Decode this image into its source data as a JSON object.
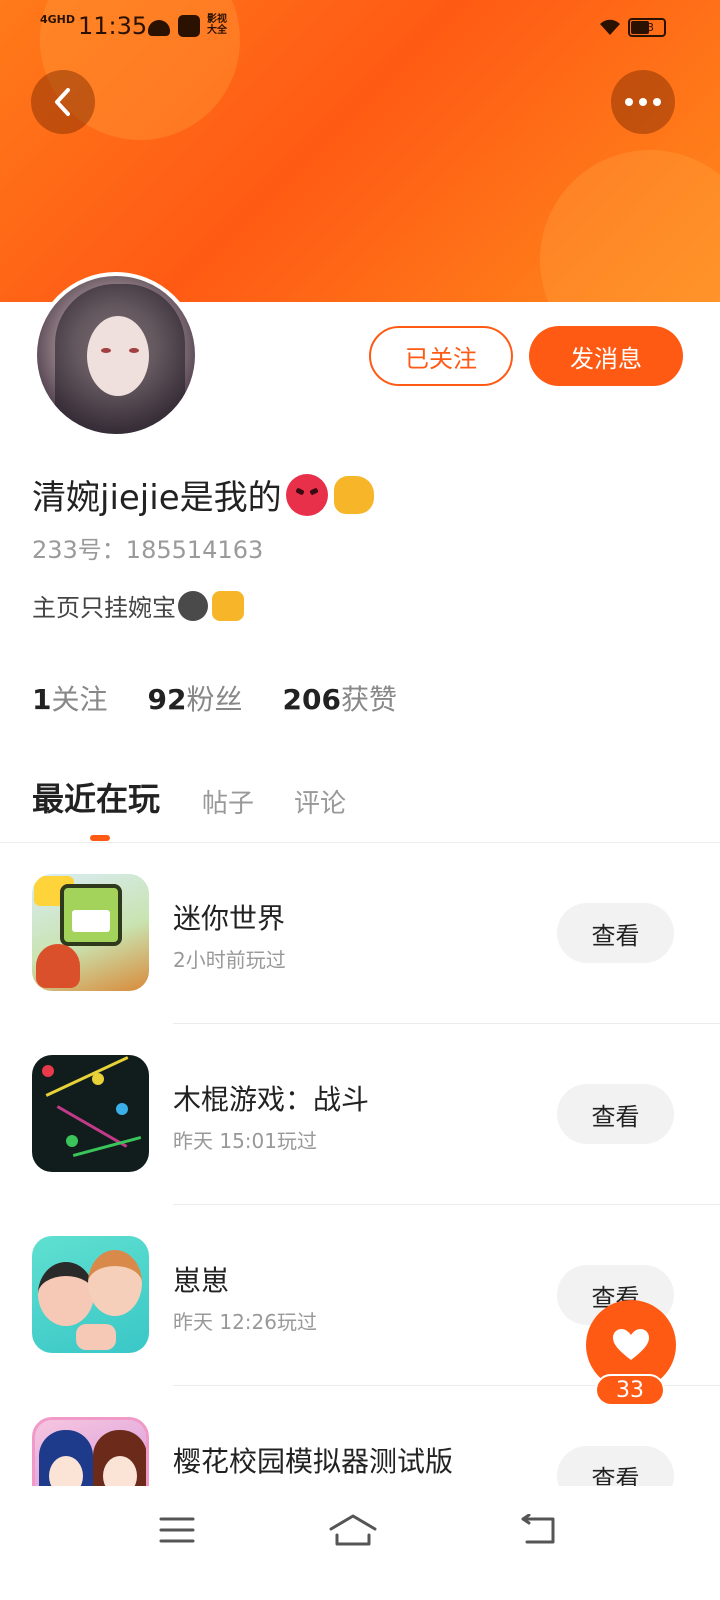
{
  "status_bar": {
    "network": "4GHD",
    "time": "11:35",
    "app_label": "影视大全",
    "battery": "43"
  },
  "profile": {
    "follow_button": "已关注",
    "message_button": "发消息",
    "username": "清婉jiejie是我的",
    "uid": "233号：185514163",
    "bio": "主页只挂婉宝"
  },
  "stats": [
    {
      "num": "1",
      "label": "关注"
    },
    {
      "num": "92",
      "label": "粉丝"
    },
    {
      "num": "206",
      "label": "获赞"
    }
  ],
  "tabs": [
    "最近在玩",
    "帖子",
    "评论"
  ],
  "games": [
    {
      "name": "迷你世界",
      "time": "2小时前玩过",
      "button": "查看"
    },
    {
      "name": "木棍游戏：战斗",
      "time": "昨天 15:01玩过",
      "button": "查看"
    },
    {
      "name": "崽崽",
      "time": "昨天 12:26玩过",
      "button": "查看"
    },
    {
      "name": "樱花校园模拟器测试版",
      "time": "",
      "button": "查看"
    }
  ],
  "fab": {
    "count": "33"
  },
  "colors": {
    "accent": "#ff5a14",
    "header": "#ff7a1a"
  },
  "icons": [
    "back-arrow-icon",
    "more-dots-icon",
    "heart-icon",
    "menu-icon",
    "home-icon",
    "return-icon"
  ]
}
